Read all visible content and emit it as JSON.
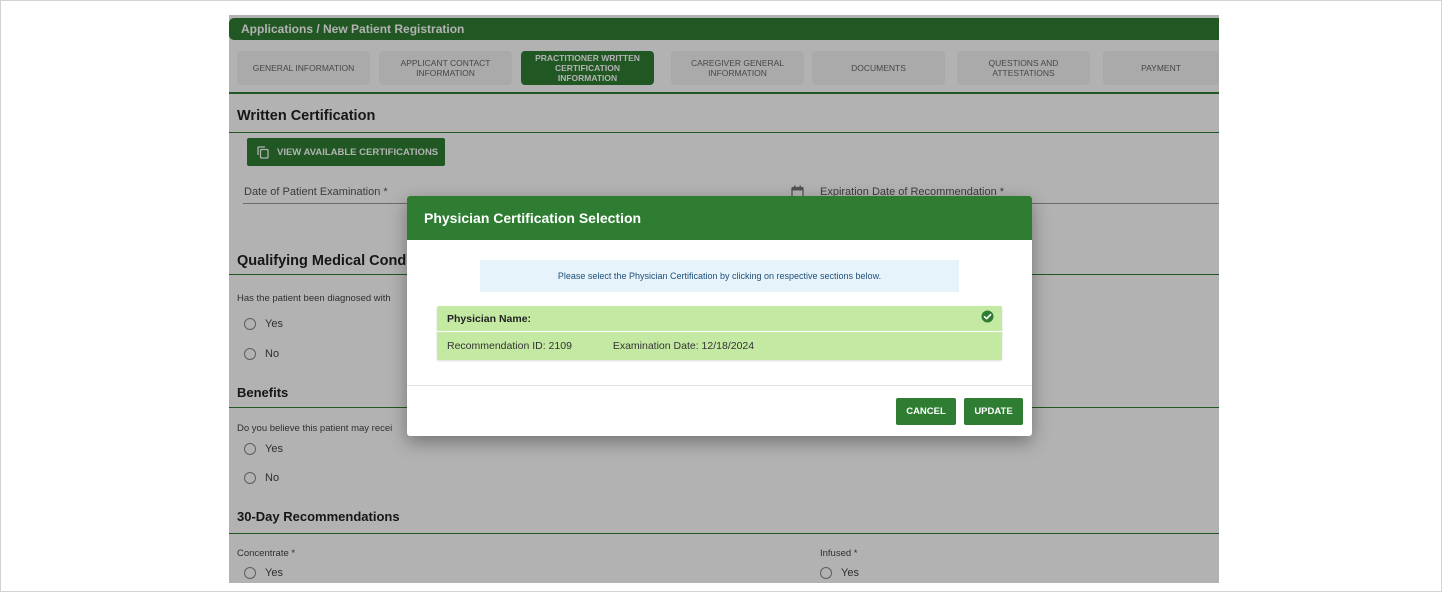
{
  "breadcrumb": {
    "text": "Applications / New Patient Registration"
  },
  "tabs": [
    {
      "label": "General Information"
    },
    {
      "label": "Applicant Contact Information"
    },
    {
      "label": "Practitioner Written Certification Information"
    },
    {
      "label": "Caregiver General Information"
    },
    {
      "label": "Documents"
    },
    {
      "label": "Questions and Attestations"
    },
    {
      "label": "Payment"
    }
  ],
  "active_tab": "Practitioner Written Certification Information",
  "written_certification": {
    "title": "Written Certification",
    "view_button": "View Available Certifications",
    "date_exam_label": "Date of Patient Examination *",
    "expiration_label": "Expiration Date of Recommendation *"
  },
  "qualifying": {
    "title": "Qualifying Medical Conditions",
    "question": "Has the patient been diagnosed with",
    "yes": "Yes",
    "no": "No"
  },
  "benefits": {
    "title": "Benefits",
    "question": "Do you believe this patient may recei",
    "yes": "Yes",
    "no": "No"
  },
  "recommendations": {
    "title": "30-Day Recommendations",
    "concentrate_label": "Concentrate *",
    "concentrate_yes": "Yes",
    "infused_label": "Infused *",
    "infused_yes": "Yes"
  },
  "modal": {
    "title": "Physician Certification Selection",
    "info": "Please select the Physician Certification by clicking on respective sections below.",
    "card": {
      "name_label": "Physician Name:",
      "recommendation_id": "Recommendation ID: 2109",
      "examination_date": "Examination Date: 12/18/2024",
      "selected": true
    },
    "cancel": "Cancel",
    "update": "Update"
  },
  "colors": {
    "primary": "#2e7d32",
    "card_selected": "#c4e9a2",
    "info_bg": "#e6f3fa",
    "overlay": "rgba(0,0,0,0.30)"
  }
}
